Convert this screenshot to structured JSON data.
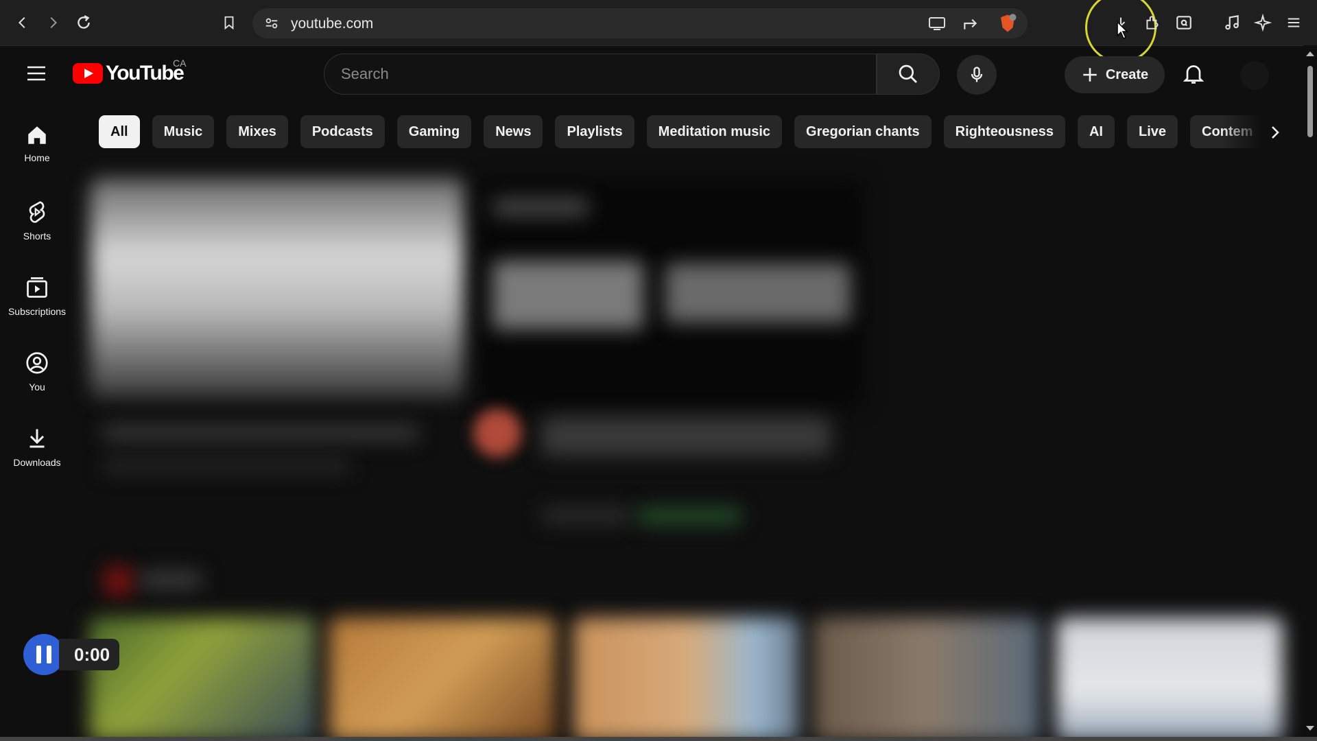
{
  "browser": {
    "url": "youtube.com",
    "icons": [
      "back-icon",
      "forward-icon",
      "reload-icon",
      "bookmark-icon",
      "site-settings-icon",
      "cast-icon",
      "share-icon",
      "brave-shield-icon",
      "download-icon",
      "extensions-icon",
      "tab-search-icon",
      "media-icon",
      "leo-ai-icon",
      "menu-icon"
    ]
  },
  "header": {
    "logo_text": "YouTube",
    "country_code": "CA",
    "search_placeholder": "Search",
    "create_label": "Create"
  },
  "sidebar": {
    "items": [
      {
        "label": "Home",
        "icon": "home-icon"
      },
      {
        "label": "Shorts",
        "icon": "shorts-icon"
      },
      {
        "label": "Subscriptions",
        "icon": "subscriptions-icon"
      },
      {
        "label": "You",
        "icon": "you-icon"
      },
      {
        "label": "Downloads",
        "icon": "downloads-icon"
      }
    ]
  },
  "chips": [
    "All",
    "Music",
    "Mixes",
    "Podcasts",
    "Gaming",
    "News",
    "Playlists",
    "Meditation music",
    "Gregorian chants",
    "Righteousness",
    "AI",
    "Live",
    "Contem"
  ],
  "recorder": {
    "time": "0:00"
  },
  "colors": {
    "background": "#0f0f0f",
    "logo_red": "#ff0000",
    "cursor_ring": "#d8d62f",
    "recorder_blue": "#2f5fd4"
  }
}
